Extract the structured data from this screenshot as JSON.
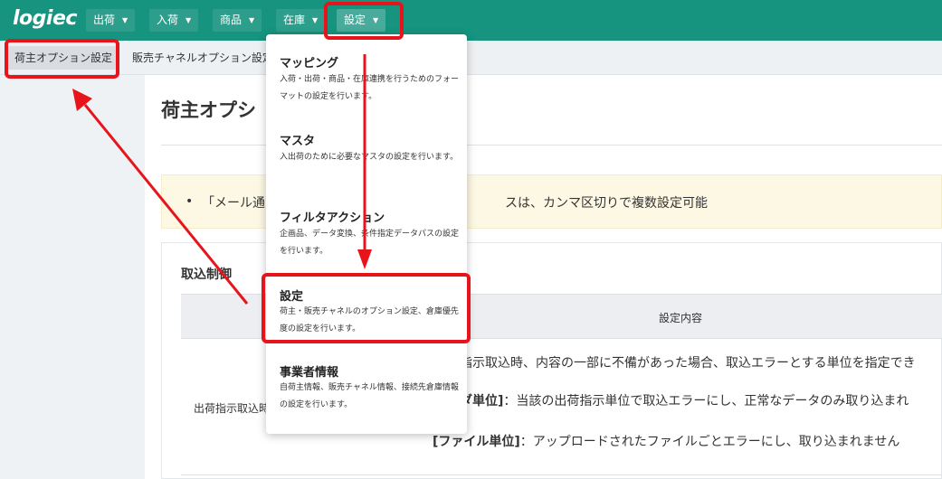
{
  "app": {
    "logo": "logiec"
  },
  "topnav": {
    "items": [
      {
        "label": "出荷"
      },
      {
        "label": "入荷"
      },
      {
        "label": "商品"
      },
      {
        "label": "在庫"
      },
      {
        "label": "設定"
      }
    ],
    "caret": "▼"
  },
  "subnav": {
    "tabs": [
      {
        "label": "荷主オプション設定"
      },
      {
        "label": "販売チャネルオプション設定"
      }
    ]
  },
  "main": {
    "title": "荷主オプシ",
    "notice": {
      "bullet": "•",
      "text_left": "「メール通",
      "text_right": "スは、カンマ区切りで複数設定可能"
    },
    "card": {
      "title": "取込制御",
      "table": {
        "column_header": "設定内容",
        "row_label": "出荷指示取込時",
        "desc_line1": "指示取込時、内容の一部に不備があった場合、取込エラーとする単位を指定でき",
        "desc_line2_bold": "ダ単位]",
        "desc_line2_rest": "：当該の出荷指示単位で取込エラーにし、正常なデータのみ取り込まれ",
        "desc_line3_bold": "[ファイル単位]",
        "desc_line3_rest": "：アップロードされたファイルごとエラーにし、取り込まれません"
      }
    }
  },
  "dropdown": {
    "items": [
      {
        "title": "マッピング",
        "desc": "入荷・出荷・商品・在庫連携を行うためのフォーマットの設定を行います。"
      },
      {
        "title": "マスタ",
        "desc": "入出荷のために必要なマスタの設定を行います。"
      },
      {
        "title": "フィルタアクション",
        "desc": "企画品、データ変換、条件指定データパスの設定を行います。"
      },
      {
        "title": "設定",
        "desc": "荷主・販売チャネルのオプション設定、倉庫優先度の設定を行います。"
      },
      {
        "title": "事業者情報",
        "desc": "自荷主情報、販売チャネル情報、接続先倉庫情報の設定を行います。"
      }
    ]
  },
  "annotation": {
    "color": "#e8141c"
  },
  "colors": {
    "brand": "#16947f",
    "notice_bg": "#fdf8e4"
  }
}
